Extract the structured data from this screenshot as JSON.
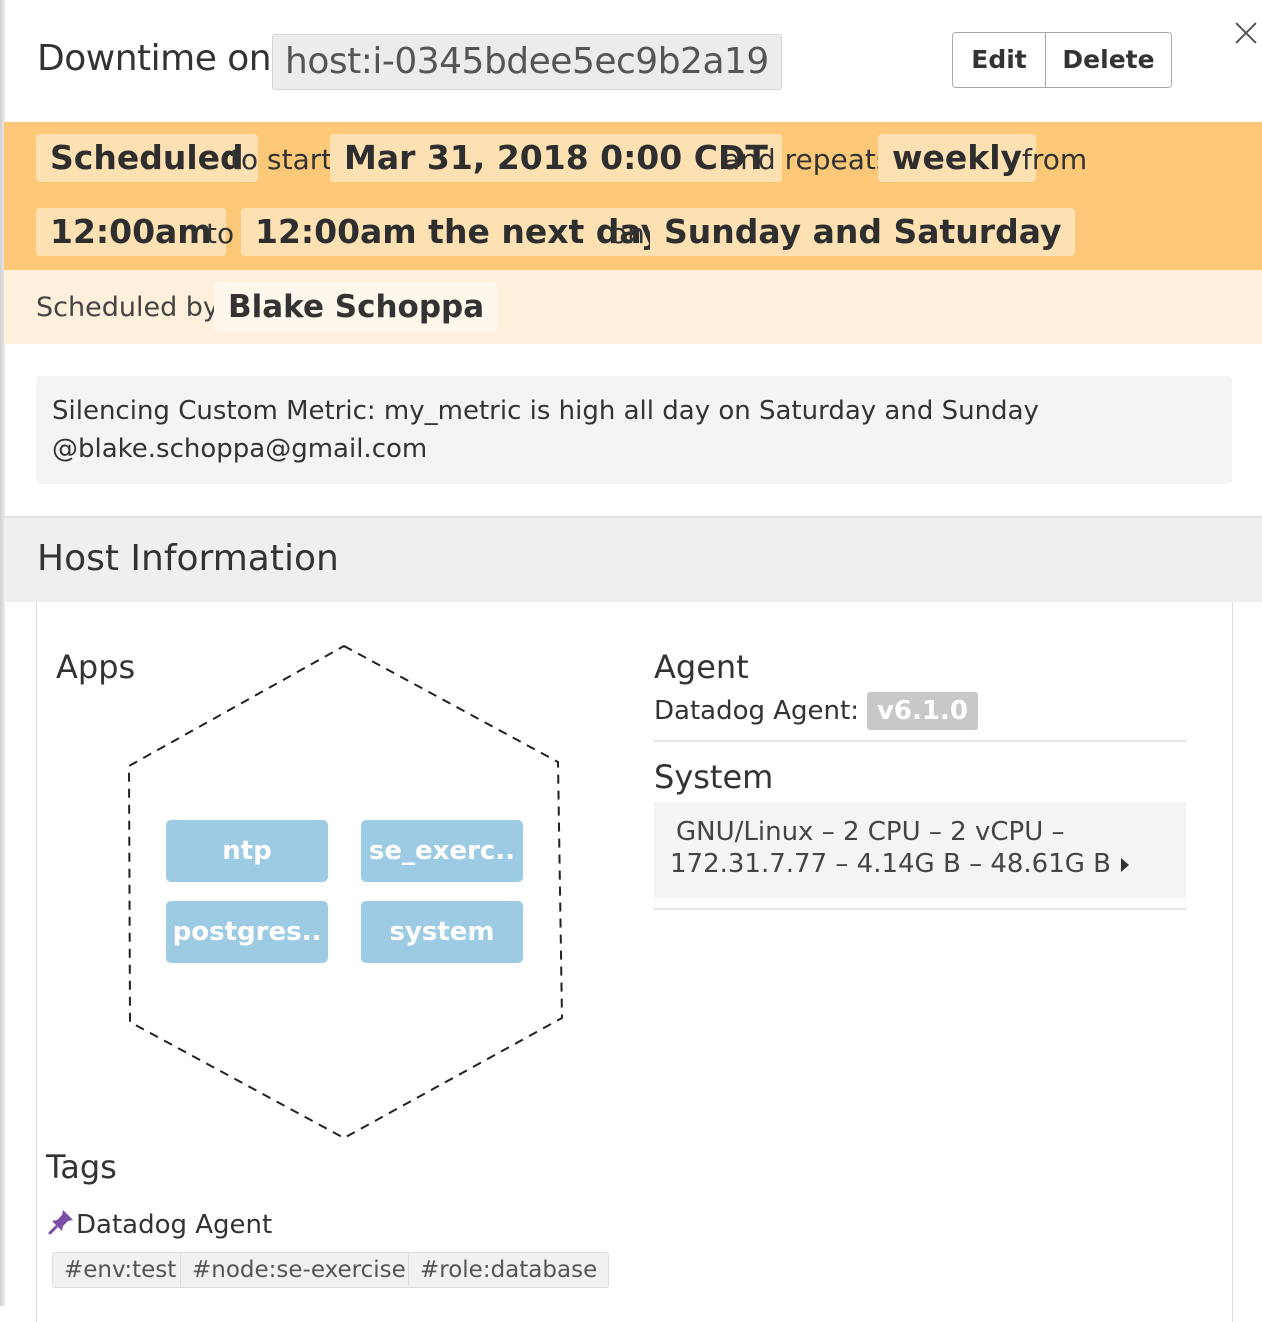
{
  "header": {
    "title_prefix": "Downtime on",
    "scope": "host:i-0345bdee5ec9b2a19",
    "edit_label": "Edit",
    "delete_label": "Delete",
    "close_icon": "close-icon"
  },
  "schedule": {
    "status": "Scheduled",
    "word_to_start": "to start",
    "start_date": "Mar 31, 2018 0:00 CDT",
    "word_and_repeats": "and repeats",
    "frequency": "weekly",
    "word_from": "from",
    "from_time": "12:00am",
    "word_to": "to",
    "to_time": "12:00am the next day",
    "word_on": "on",
    "days": "Sunday and Saturday"
  },
  "scheduled_by": {
    "label": "Scheduled by",
    "user": "Blake Schoppa"
  },
  "message": {
    "line1": "Silencing Custom Metric: my_metric is high all day on Saturday and Sunday",
    "line2": "@blake.schoppa@gmail.com"
  },
  "host_info": {
    "title": "Host Information",
    "apps_title": "Apps",
    "apps": [
      "ntp",
      "se_exerc..",
      "postgres..",
      "system"
    ],
    "agent_title": "Agent",
    "agent_label": "Datadog Agent:",
    "agent_version": "v6.1.0",
    "system_title": "System",
    "system_line1": "GNU/Linux – 2 CPU – 2 vCPU –",
    "system_line2": "172.31.7.77 – 4.14G B – 48.61G B",
    "tags_title": "Tags",
    "tag_source": "Datadog Agent",
    "tags": [
      "#env:test",
      "#node:se-exercise",
      "#role:database"
    ]
  },
  "colors": {
    "schedule_bg": "#fdc979",
    "chip_bg": "#fde1b3",
    "byline_bg": "#fef0db",
    "app_tile": "#9ccbe3",
    "version_badge": "#c8c8c8"
  }
}
